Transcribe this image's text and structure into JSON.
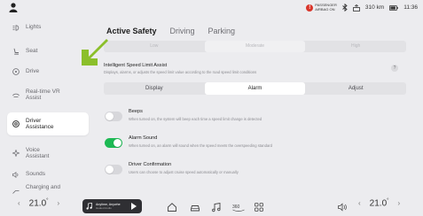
{
  "status": {
    "airbag_line1": "PASSENGER",
    "airbag_line2": "AIRBAG ON",
    "range": "310 km",
    "time": "11:36"
  },
  "sidebar": {
    "items": [
      {
        "label": "Lights"
      },
      {
        "label": "Seat"
      },
      {
        "label": "Drive"
      },
      {
        "label": "Real-time VR",
        "label2": "Assist"
      },
      {
        "label": "Driver",
        "label2": "Assistance"
      },
      {
        "label": "Voice",
        "label2": "Assistant"
      },
      {
        "label": "Sounds"
      },
      {
        "label": "Charging and"
      }
    ]
  },
  "tabs": [
    {
      "label": "Active Safety"
    },
    {
      "label": "Driving"
    },
    {
      "label": "Parking"
    }
  ],
  "sensitivity": {
    "options": [
      "Low",
      "Moderate",
      "High"
    ]
  },
  "isla": {
    "title": "Intelligent Speed Limit Assist",
    "description": "Displays, alarms, or adjusts the speed limit value according to the road speed limit conditions",
    "info": "?",
    "modes": [
      "Display",
      "Alarm",
      "Adjust"
    ]
  },
  "options": [
    {
      "title": "Beeps",
      "desc": "When turned on, the system will beep each time a speed limit change is detected",
      "on": false
    },
    {
      "title": "Alarm Sound",
      "desc": "When turned on, an alarm will sound when the speed meets the overspeeding standard",
      "on": true
    },
    {
      "title": "Driver Confirmation",
      "desc": "Users can choose to adjust cruise speed automatically or manually",
      "on": false
    }
  ],
  "dock": {
    "temp_left": "21.0",
    "temp_right": "21.0",
    "temp_unit": "°",
    "music_title": "Anytime, Anywhe",
    "music_sub": "Healed Audio",
    "climate_label": "360"
  },
  "colors": {
    "toggle_on": "#1db954",
    "arrow": "#8bbf2a",
    "airbag": "#d9362b"
  }
}
